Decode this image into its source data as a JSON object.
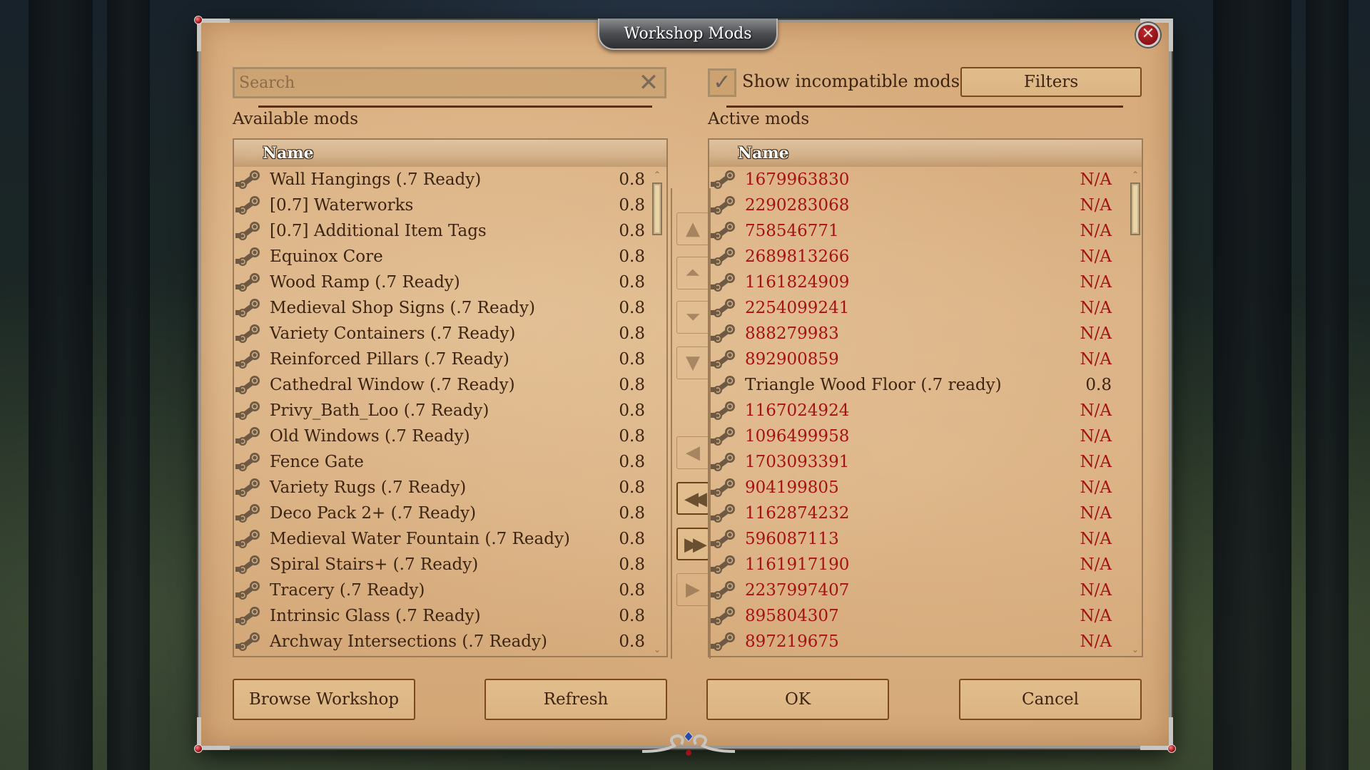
{
  "dialog": {
    "title": "Workshop Mods",
    "close_label": "✕"
  },
  "search": {
    "placeholder": "Search",
    "value": "",
    "clear_icon": "✕"
  },
  "show_incompatible": {
    "label": "Show incompatible mods",
    "checked": true,
    "check_glyph": "✓"
  },
  "filters_label": "Filters",
  "available": {
    "label": "Available mods",
    "column_name": "Name",
    "scroll_position": 0.0,
    "items": [
      {
        "name": "Wall Hangings (.7 Ready)",
        "version": "0.8"
      },
      {
        "name": "[0.7] Waterworks",
        "version": "0.8"
      },
      {
        "name": "[0.7] Additional Item Tags",
        "version": "0.8"
      },
      {
        "name": "Equinox Core",
        "version": "0.8"
      },
      {
        "name": "Wood Ramp (.7 Ready)",
        "version": "0.8"
      },
      {
        "name": "Medieval Shop Signs (.7 Ready)",
        "version": "0.8"
      },
      {
        "name": "Variety Containers (.7 Ready)",
        "version": "0.8"
      },
      {
        "name": "Reinforced Pillars (.7 Ready)",
        "version": "0.8"
      },
      {
        "name": "Cathedral Window (.7 Ready)",
        "version": "0.8"
      },
      {
        "name": "Privy_Bath_Loo (.7 Ready)",
        "version": "0.8"
      },
      {
        "name": "Old Windows (.7 Ready)",
        "version": "0.8"
      },
      {
        "name": "Fence Gate",
        "version": "0.8"
      },
      {
        "name": "Variety Rugs (.7 Ready)",
        "version": "0.8"
      },
      {
        "name": "Deco Pack 2+ (.7 Ready)",
        "version": "0.8"
      },
      {
        "name": "Medieval Water Fountain (.7 Ready)",
        "version": "0.8"
      },
      {
        "name": "Spiral Stairs+ (.7 Ready)",
        "version": "0.8"
      },
      {
        "name": "Tracery (.7 Ready)",
        "version": "0.8"
      },
      {
        "name": "Intrinsic Glass (.7 Ready)",
        "version": "0.8"
      },
      {
        "name": "Archway Intersections (.7 Ready)",
        "version": "0.8"
      }
    ]
  },
  "active": {
    "label": "Active mods",
    "column_name": "Name",
    "scroll_position": 0.0,
    "items": [
      {
        "name": "1679963830",
        "version": "N/A",
        "missing": true
      },
      {
        "name": "2290283068",
        "version": "N/A",
        "missing": true
      },
      {
        "name": "758546771",
        "version": "N/A",
        "missing": true
      },
      {
        "name": "2689813266",
        "version": "N/A",
        "missing": true
      },
      {
        "name": "1161824909",
        "version": "N/A",
        "missing": true
      },
      {
        "name": "2254099241",
        "version": "N/A",
        "missing": true
      },
      {
        "name": "888279983",
        "version": "N/A",
        "missing": true
      },
      {
        "name": "892900859",
        "version": "N/A",
        "missing": true
      },
      {
        "name": "Triangle Wood Floor (.7 ready)",
        "version": "0.8",
        "missing": false
      },
      {
        "name": "1167024924",
        "version": "N/A",
        "missing": true
      },
      {
        "name": "1096499958",
        "version": "N/A",
        "missing": true
      },
      {
        "name": "1703093391",
        "version": "N/A",
        "missing": true
      },
      {
        "name": "904199805",
        "version": "N/A",
        "missing": true
      },
      {
        "name": "1162874232",
        "version": "N/A",
        "missing": true
      },
      {
        "name": "596087113",
        "version": "N/A",
        "missing": true
      },
      {
        "name": "1161917190",
        "version": "N/A",
        "missing": true
      },
      {
        "name": "2237997407",
        "version": "N/A",
        "missing": true
      },
      {
        "name": "895804307",
        "version": "N/A",
        "missing": true
      },
      {
        "name": "897219675",
        "version": "N/A",
        "missing": true
      }
    ]
  },
  "transfer_buttons": [
    {
      "name": "move-to-top-button",
      "glyph": "▲",
      "enabled": false
    },
    {
      "name": "move-up-button",
      "glyph": "⏶",
      "enabled": false
    },
    {
      "name": "move-down-button",
      "glyph": "⏷",
      "enabled": false
    },
    {
      "name": "move-to-bottom-button",
      "glyph": "▼",
      "enabled": false
    },
    {
      "name": "deactivate-mod-button",
      "glyph": "◀",
      "enabled": false
    },
    {
      "name": "deactivate-all-button",
      "glyph": "◀◀",
      "enabled": true
    },
    {
      "name": "activate-all-button",
      "glyph": "▶▶",
      "enabled": true
    },
    {
      "name": "activate-mod-button",
      "glyph": "▶",
      "enabled": false
    }
  ],
  "footer": {
    "browse_workshop": "Browse Workshop",
    "refresh": "Refresh",
    "ok": "OK",
    "cancel": "Cancel"
  },
  "colors": {
    "parchment": "#d7aa7a",
    "text_brown": "#3c2410",
    "missing_red": "#a41216"
  }
}
